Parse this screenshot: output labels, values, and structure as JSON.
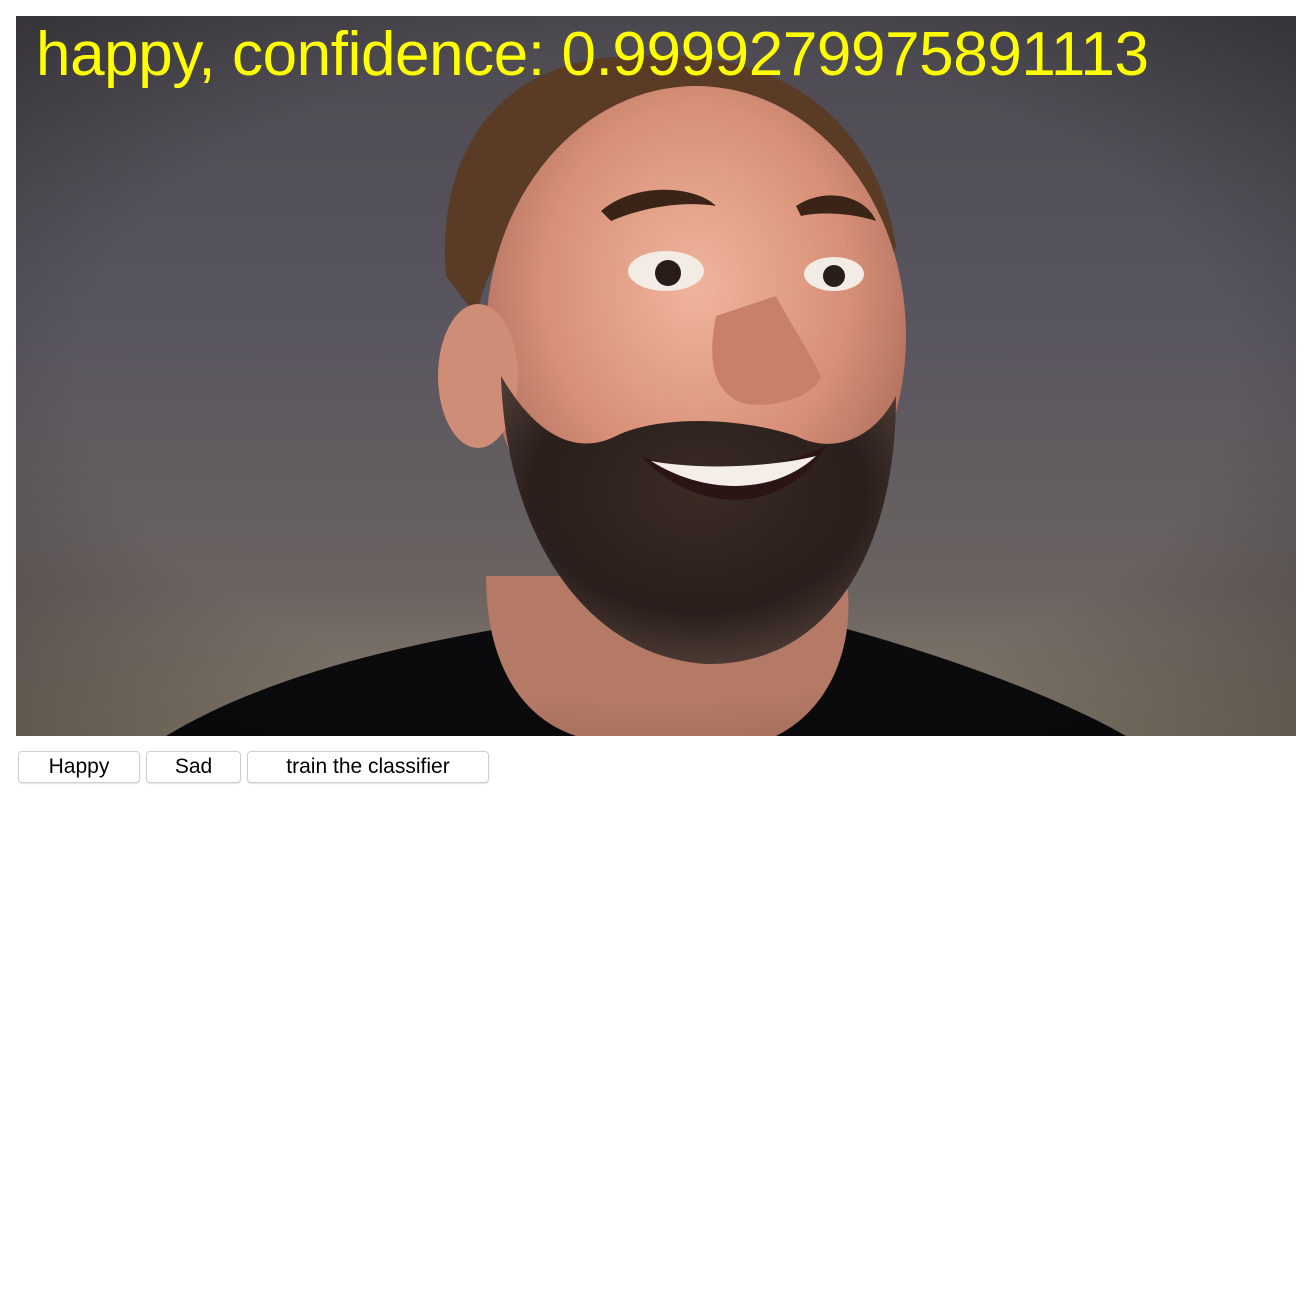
{
  "video": {
    "prediction_text": "happy, confidence: 0.9999279975891113",
    "overlay_color": "#ffff00",
    "image_description_icon": "webcam-frame"
  },
  "controls": {
    "happy_label": "Happy",
    "sad_label": "Sad",
    "train_label": "train the classifier"
  }
}
